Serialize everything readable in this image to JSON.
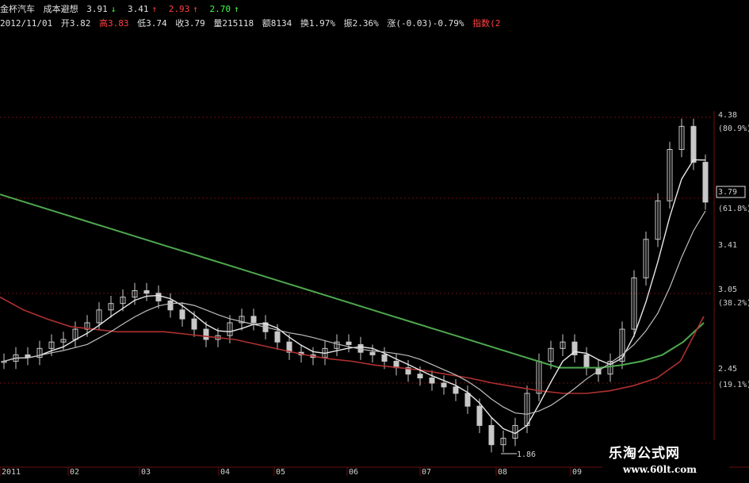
{
  "info": {
    "name": "金杯汽车",
    "indicator": "成本避想",
    "v1": "3.91",
    "v2": "3.41",
    "v3": "2.93",
    "v4": "2.70",
    "date": "2012/11/01",
    "open": "开3.82",
    "high": "高3.83",
    "low": "低3.74",
    "close": "收3.79",
    "volume": "量215118",
    "amount": "额8134",
    "turnover": "换1.97%",
    "amplitude": "振2.36%",
    "change": "涨(-0.03)-0.79%",
    "index": "指数(2"
  },
  "price_axis": {
    "labels": [
      "4.38",
      "(80.9%)",
      "3.79",
      "(61.8%)",
      "3.41",
      "3.05",
      "(38.2%)",
      "2.45",
      "(19.1%)"
    ]
  },
  "time_axis": {
    "labels": [
      "2011",
      "02",
      "03",
      "04",
      "05",
      "06",
      "07",
      "08",
      "09"
    ]
  },
  "annotations": {
    "low_label": "1.86"
  },
  "colors": {
    "green_ma": "#4ea84e",
    "red_ma": "#b03030",
    "white_ma": "#e8e8e8",
    "candle": "#c8c8c8",
    "grid": "#6a1010"
  },
  "chart_data": {
    "type": "line",
    "title": "",
    "price_series_close": [
      2.55,
      2.6,
      2.58,
      2.65,
      2.7,
      2.72,
      2.8,
      2.85,
      2.95,
      3.0,
      3.05,
      3.1,
      3.08,
      3.02,
      2.95,
      2.88,
      2.8,
      2.72,
      2.75,
      2.85,
      2.9,
      2.85,
      2.78,
      2.7,
      2.62,
      2.6,
      2.58,
      2.65,
      2.7,
      2.68,
      2.62,
      2.6,
      2.55,
      2.5,
      2.45,
      2.42,
      2.38,
      2.35,
      2.3,
      2.2,
      2.05,
      1.9,
      1.95,
      2.05,
      2.3,
      2.55,
      2.65,
      2.7,
      2.6,
      2.5,
      2.45,
      2.55,
      2.8,
      3.2,
      3.5,
      3.8,
      4.2,
      4.38,
      4.1,
      3.79
    ],
    "series": [
      {
        "name": "",
        "values": [
          3.85,
          3.8,
          3.75,
          3.7,
          3.65,
          3.6,
          3.55,
          3.5,
          3.45,
          3.4,
          3.35,
          3.3,
          3.25,
          3.2,
          3.15,
          3.1,
          3.05,
          3.0,
          2.95,
          2.9,
          2.85,
          2.8,
          2.75,
          2.7,
          2.65,
          2.6,
          2.55,
          2.5,
          2.5,
          2.5,
          2.52,
          2.55,
          2.6,
          2.7,
          2.85
        ]
      },
      {
        "name": "",
        "values": [
          3.05,
          2.95,
          2.88,
          2.82,
          2.8,
          2.78,
          2.78,
          2.78,
          2.76,
          2.74,
          2.72,
          2.68,
          2.64,
          2.6,
          2.57,
          2.55,
          2.52,
          2.5,
          2.48,
          2.45,
          2.42,
          2.38,
          2.35,
          2.32,
          2.3,
          2.3,
          2.32,
          2.36,
          2.42,
          2.55,
          2.9
        ]
      }
    ]
  }
}
